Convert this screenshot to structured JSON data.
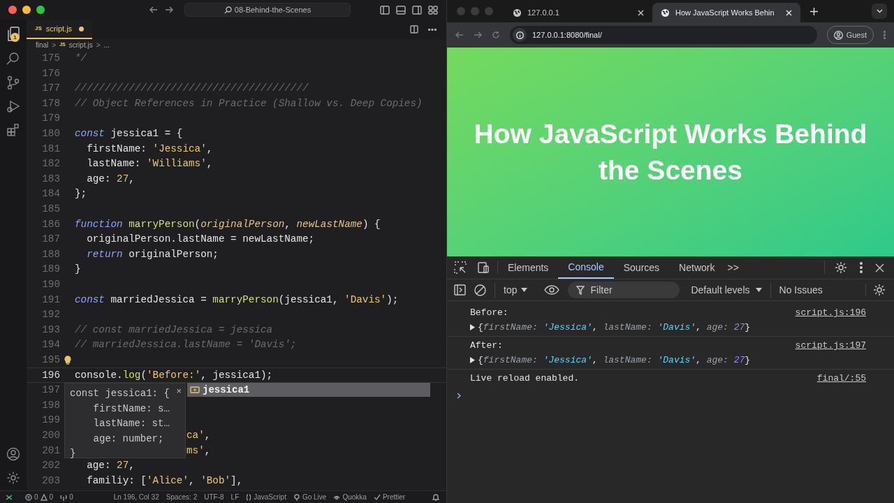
{
  "editor_window": {
    "title": "08-Behind-the-Scenes",
    "explorer_badge": "1",
    "tab": {
      "icon_label": "JS",
      "label": "script.js",
      "modified": true,
      "selected": true
    },
    "breadcrumb": [
      {
        "kind": "text",
        "text": "final"
      },
      {
        "kind": "sep",
        "text": ">"
      },
      {
        "kind": "js",
        "text": "JS"
      },
      {
        "kind": "text",
        "text": "script.js"
      },
      {
        "kind": "sep",
        "text": ">"
      },
      {
        "kind": "text",
        "text": "..."
      }
    ],
    "lines": [
      {
        "n": "175",
        "tokens": [
          {
            "t": "*/",
            "kind": "cmt"
          }
        ]
      },
      {
        "n": "176"
      },
      {
        "n": "177",
        "tokens": [
          {
            "t": "///////////////////////////////////////",
            "kind": "cmt"
          }
        ]
      },
      {
        "n": "178",
        "tokens": [
          {
            "t": "// Object References in Practice (Shallow vs. Deep Copies)",
            "kind": "cmt"
          }
        ]
      },
      {
        "n": "179"
      },
      {
        "n": "180",
        "tokens": [
          {
            "t": "const",
            "kind": "kw"
          },
          {
            "t": " jessica1 = {",
            "kind": "plain"
          }
        ]
      },
      {
        "n": "181",
        "tokens": [
          {
            "t": "  firstName: ",
            "kind": "plain"
          },
          {
            "t": "'Jessica'",
            "kind": "str"
          },
          {
            "t": ",",
            "kind": "plain"
          }
        ]
      },
      {
        "n": "182",
        "tokens": [
          {
            "t": "  lastName: ",
            "kind": "plain"
          },
          {
            "t": "'Williams'",
            "kind": "str"
          },
          {
            "t": ",",
            "kind": "plain"
          }
        ]
      },
      {
        "n": "183",
        "tokens": [
          {
            "t": "  age: ",
            "kind": "plain"
          },
          {
            "t": "27",
            "kind": "num"
          },
          {
            "t": ",",
            "kind": "plain"
          }
        ]
      },
      {
        "n": "184",
        "tokens": [
          {
            "t": "};",
            "kind": "plain"
          }
        ]
      },
      {
        "n": "185"
      },
      {
        "n": "186",
        "tokens": [
          {
            "t": "function",
            "kind": "kw"
          },
          {
            "t": " marryPerson",
            "kind": "fn"
          },
          {
            "t": "(",
            "kind": "plain"
          },
          {
            "t": "originalPerson",
            "kind": "param"
          },
          {
            "t": ", ",
            "kind": "plain"
          },
          {
            "t": "newLastName",
            "kind": "param"
          },
          {
            "t": ") {",
            "kind": "plain"
          }
        ]
      },
      {
        "n": "187",
        "tokens": [
          {
            "t": "  originalPerson.lastName = newLastName;",
            "kind": "plain"
          }
        ]
      },
      {
        "n": "188",
        "tokens": [
          {
            "t": "  return",
            "kind": "kw"
          },
          {
            "t": " originalPerson;",
            "kind": "plain"
          }
        ]
      },
      {
        "n": "189",
        "tokens": [
          {
            "t": "}",
            "kind": "plain"
          }
        ]
      },
      {
        "n": "190"
      },
      {
        "n": "191",
        "tokens": [
          {
            "t": "const",
            "kind": "kw"
          },
          {
            "t": " marriedJessica = ",
            "kind": "plain"
          },
          {
            "t": "marryPerson",
            "kind": "fn"
          },
          {
            "t": "(jessica1, ",
            "kind": "plain"
          },
          {
            "t": "'Davis'",
            "kind": "str"
          },
          {
            "t": ");",
            "kind": "plain"
          }
        ]
      },
      {
        "n": "192"
      },
      {
        "n": "193",
        "tokens": [
          {
            "t": "// const marriedJessica = jessica",
            "kind": "cmt"
          }
        ]
      },
      {
        "n": "194",
        "tokens": [
          {
            "t": "// marriedJessica.lastName = 'Davis';",
            "kind": "cmt"
          }
        ]
      },
      {
        "n": "195",
        "bulb": true
      },
      {
        "n": "196",
        "current": true,
        "tokens": [
          {
            "t": "console",
            "kind": "plain"
          },
          {
            "t": ".",
            "kind": "plain"
          },
          {
            "t": "log",
            "kind": "fn"
          },
          {
            "t": "(",
            "kind": "plain"
          },
          {
            "t": "'Before:'",
            "kind": "str"
          },
          {
            "t": ", jessica1",
            "kind": "plain"
          },
          {
            "t": ");",
            "kind": "plain"
          }
        ]
      },
      {
        "n": "197"
      },
      {
        "n": "198"
      },
      {
        "n": "199"
      },
      {
        "n": "200",
        "partial": true,
        "tokens": [
          {
            "t": "ca'",
            "kind": "str"
          },
          {
            "t": ",",
            "kind": "plain"
          }
        ]
      },
      {
        "n": "201",
        "partial": true,
        "tokens": [
          {
            "t": "ms'",
            "kind": "str"
          },
          {
            "t": ",",
            "kind": "plain"
          }
        ]
      },
      {
        "n": "202",
        "tokens": [
          {
            "t": "  age: ",
            "kind": "plain"
          },
          {
            "t": "27",
            "kind": "num"
          },
          {
            "t": ",",
            "kind": "plain"
          }
        ]
      },
      {
        "n": "203",
        "tokens": [
          {
            "t": "  familiy: [",
            "kind": "plain"
          },
          {
            "t": "'Alice'",
            "kind": "str"
          },
          {
            "t": ", ",
            "kind": "plain"
          },
          {
            "t": "'Bob'",
            "kind": "str"
          },
          {
            "t": "],",
            "kind": "plain"
          }
        ]
      }
    ],
    "hover": {
      "lines": [
        "const jessica1: {",
        "    firstName: s…",
        "    lastName: st…",
        "    age: number;",
        "}"
      ],
      "close": "×"
    },
    "suggestion": {
      "label": "jessica1",
      "selected": true
    },
    "status_bar": {
      "errors": "0",
      "warnings": "0",
      "ports": "0",
      "position": "Ln 196, Col 32",
      "spaces": "Spaces: 2",
      "encoding": "UTF-8",
      "eol": "LF",
      "language": "JavaScript",
      "go_live": "Go Live",
      "quokka": "Quokka",
      "prettier": "Prettier"
    }
  },
  "browser": {
    "tabs": [
      {
        "label": "127.0.0.1",
        "selected": false
      },
      {
        "label": "How JavaScript Works Behin",
        "selected": true
      }
    ],
    "address": "127.0.0.1:8080/final/",
    "profile": "Guest",
    "page": {
      "heading": "How JavaScript Works Behind the Scenes"
    },
    "devtools": {
      "tabs": [
        {
          "label": "Elements",
          "selected": false
        },
        {
          "label": "Console",
          "selected": true
        },
        {
          "label": "Sources",
          "selected": false
        },
        {
          "label": "Network",
          "selected": false
        }
      ],
      "more": ">>",
      "context": "top",
      "filter_placeholder": "Filter",
      "levels": "Default levels",
      "issues": "No Issues",
      "messages": [
        {
          "kind": "object",
          "label": "Before:",
          "source": "script.js:196",
          "preview": [
            {
              "t": "{",
              "kind": "punct"
            },
            {
              "t": "firstName: ",
              "kind": "key"
            },
            {
              "t": "'Jessica'",
              "kind": "string"
            },
            {
              "t": ", ",
              "kind": "punct"
            },
            {
              "t": "lastName: ",
              "kind": "key"
            },
            {
              "t": "'Davis'",
              "kind": "string"
            },
            {
              "t": ", ",
              "kind": "punct"
            },
            {
              "t": "age: ",
              "kind": "key"
            },
            {
              "t": "27",
              "kind": "number"
            },
            {
              "t": "}",
              "kind": "punct"
            }
          ]
        },
        {
          "kind": "object",
          "label": "After:",
          "source": "script.js:197",
          "preview": [
            {
              "t": "{",
              "kind": "punct"
            },
            {
              "t": "firstName: ",
              "kind": "key"
            },
            {
              "t": "'Jessica'",
              "kind": "string"
            },
            {
              "t": ", ",
              "kind": "punct"
            },
            {
              "t": "lastName: ",
              "kind": "key"
            },
            {
              "t": "'Davis'",
              "kind": "string"
            },
            {
              "t": ", ",
              "kind": "punct"
            },
            {
              "t": "age: ",
              "kind": "key"
            },
            {
              "t": "27",
              "kind": "number"
            },
            {
              "t": "}",
              "kind": "punct"
            }
          ]
        },
        {
          "kind": "text",
          "label": "Live reload enabled.",
          "source": "final/:55"
        }
      ]
    }
  }
}
